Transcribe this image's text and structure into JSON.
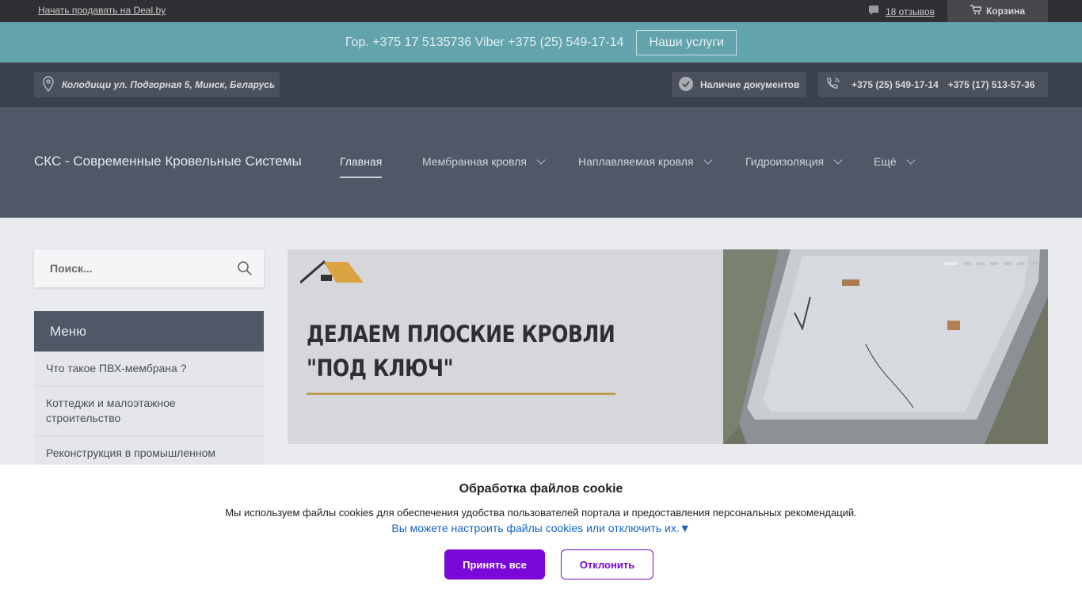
{
  "topbar": {
    "sell_link": "Начать продавать на Deal.by",
    "reviews_link": "18 отзывов",
    "cart_label": "Корзина"
  },
  "phonebar": {
    "phones_text": "Гор. +375 17 5135736 Viber +375 (25) 549-17-14",
    "services_button": "Наши услуги"
  },
  "infobar": {
    "address": "Колодищи ул. Подгорная 5, Минск, Беларусь",
    "documents": "Наличие документов",
    "phone_1": "+375 (25) 549-17-14",
    "phone_2": "+375 (17) 513-57-36"
  },
  "navbar": {
    "brand": "СКС - Современные Кровельные Системы",
    "items": [
      {
        "label": "Главная"
      },
      {
        "label": "Мембранная кровля"
      },
      {
        "label": "Наплавляемая кровля"
      },
      {
        "label": "Гидроизоляция"
      },
      {
        "label": "Ещё"
      }
    ]
  },
  "search": {
    "placeholder": "Поиск..."
  },
  "menu": {
    "title": "Меню",
    "items": [
      "Что такое ПВХ-мембрана ?",
      "Коттеджи и малоэтажное строительство",
      "Реконструкция в промышленном"
    ]
  },
  "slider": {
    "headline_line1": "ДЕЛАЕМ ПЛОСКИЕ КРОВЛИ",
    "headline_line2": "\"ПОД КЛЮЧ\""
  },
  "cookie": {
    "title": "Обработка файлов cookie",
    "text": "Мы используем файлы cookies для обеспечения удобства пользователей портала и предоставления персональных рекомендаций.",
    "settings_link": "Вы можете настроить файлы cookies или отключить их.▼",
    "accept_label": "Принять все",
    "decline_label": "Отклонить"
  },
  "colors": {
    "accent": "#7a08d8",
    "phonebar": "#63a3ac",
    "navbar": "#4e5867"
  }
}
